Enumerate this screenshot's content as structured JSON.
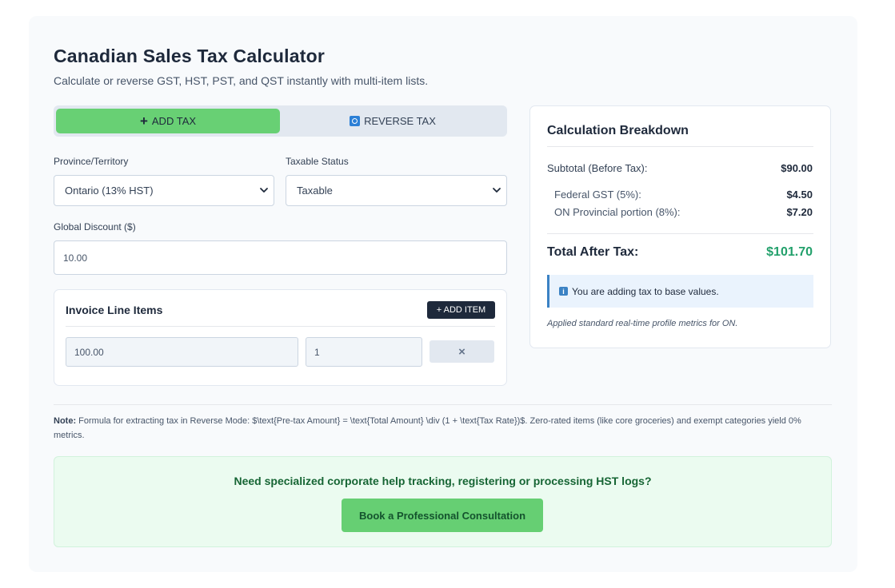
{
  "header": {
    "title": "Canadian Sales Tax Calculator",
    "subtitle": "Calculate or reverse GST, HST, PST, and QST instantly with multi-item lists."
  },
  "mode_toggle": {
    "add_label": "ADD TAX",
    "reverse_label": "REVERSE TAX",
    "active": "add"
  },
  "form": {
    "province_label": "Province/Territory",
    "province_value": "Ontario (13% HST)",
    "taxable_label": "Taxable Status",
    "taxable_value": "Taxable",
    "discount_label": "Global Discount ($)",
    "discount_value": "10.00"
  },
  "line_items": {
    "title": "Invoice Line Items",
    "add_button": "+ ADD ITEM",
    "items": [
      {
        "price": "100.00",
        "quantity": "1",
        "remove": "×"
      }
    ]
  },
  "breakdown": {
    "title": "Calculation Breakdown",
    "subtotal_label": "Subtotal (Before Tax):",
    "subtotal_value": "$90.00",
    "federal_label": "Federal GST (5%):",
    "federal_value": "$4.50",
    "provincial_label": "ON Provincial portion (8%):",
    "provincial_value": "$7.20",
    "total_label": "Total After Tax:",
    "total_value": "$101.70",
    "info_icon_text": "i",
    "info_text": "You are adding tax to base values.",
    "footnote": "Applied standard real-time profile metrics for ON."
  },
  "note": {
    "prefix": "Note:",
    "text": "Formula for extracting tax in Reverse Mode: $\\text{Pre-tax Amount} = \\text{Total Amount} \\div (1 + \\text{Tax Rate})$. Zero-rated items (like core groceries) and exempt categories yield 0% metrics."
  },
  "cta": {
    "text": "Need specialized corporate help tracking, registering or processing HST logs?",
    "button": "Book a Professional Consultation"
  },
  "colors": {
    "accent_green": "#68d074",
    "total_green": "#22a06b",
    "dark_navy": "#1e293b",
    "info_blue": "#3b82c4"
  }
}
